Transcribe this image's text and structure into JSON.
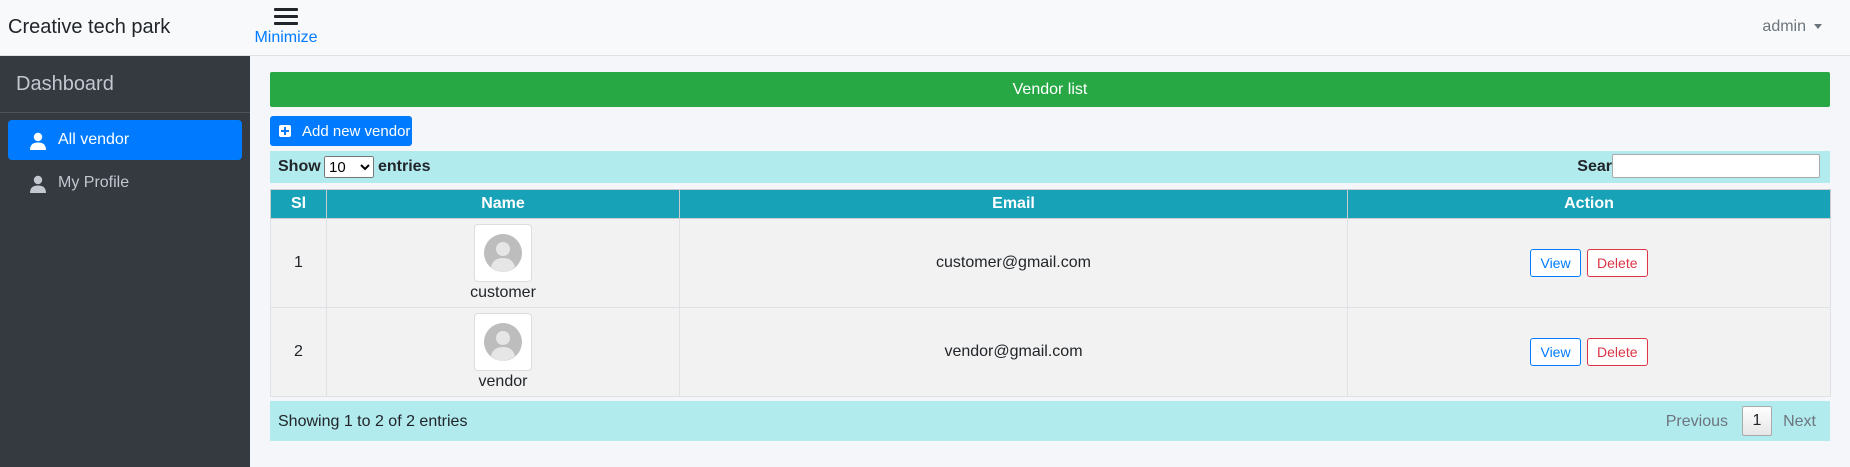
{
  "header": {
    "brand": "Creative tech park",
    "menu_label": "Minimize",
    "user": "admin"
  },
  "sidebar": {
    "title": "Dashboard",
    "items": [
      {
        "label": "All vendor",
        "icon": "user-icon",
        "active": true
      },
      {
        "label": "My Profile",
        "icon": "user-icon",
        "active": false
      }
    ]
  },
  "main": {
    "banner": "Vendor list",
    "add_button": "Add new vendor",
    "show_label": "Show",
    "entries_value": "10",
    "entries_label": "entries",
    "search_label": "Search:",
    "search_value": ""
  },
  "table": {
    "columns": [
      "Sl",
      "Name",
      "Email",
      "Action"
    ],
    "rows": [
      {
        "sl": "1",
        "name": "customer",
        "email": "customer@gmail.com",
        "view": "View",
        "delete": "Delete"
      },
      {
        "sl": "2",
        "name": "vendor",
        "email": "vendor@gmail.com",
        "view": "View",
        "delete": "Delete"
      }
    ]
  },
  "footer": {
    "info": "Showing 1 to 2 of 2 entries",
    "previous": "Previous",
    "page": "1",
    "next": "Next"
  },
  "colors": {
    "banner": "#28a745",
    "primary": "#007bff",
    "sidebar": "#343a40",
    "table_header": "#17a2b8",
    "table_controls": "#b2ebee",
    "danger": "#dc3545"
  }
}
